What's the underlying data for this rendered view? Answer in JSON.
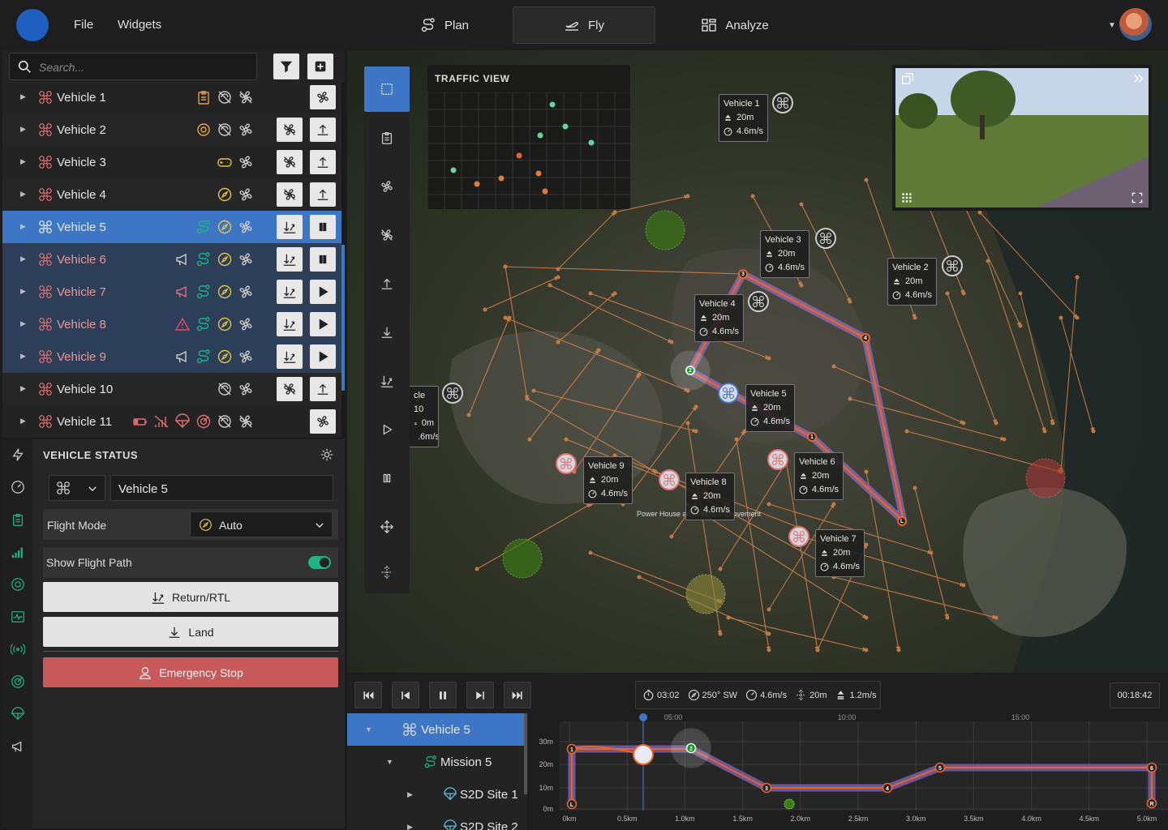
{
  "header": {
    "menu": [
      "File",
      "Widgets"
    ],
    "tabs": [
      {
        "label": "Plan",
        "icon": "route-icon",
        "active": false
      },
      {
        "label": "Fly",
        "icon": "plane-icon",
        "active": true
      },
      {
        "label": "Analyze",
        "icon": "dashboard-icon",
        "active": false
      }
    ]
  },
  "vehicles": {
    "search_placeholder": "Search...",
    "items": [
      {
        "name": "Vehicle 1",
        "state": "normal"
      },
      {
        "name": "Vehicle 2",
        "state": "normal"
      },
      {
        "name": "Vehicle 3",
        "state": "normal"
      },
      {
        "name": "Vehicle 4",
        "state": "normal"
      },
      {
        "name": "Vehicle 5",
        "state": "selected"
      },
      {
        "name": "Vehicle 6",
        "state": "group"
      },
      {
        "name": "Vehicle 7",
        "state": "group"
      },
      {
        "name": "Vehicle 8",
        "state": "group"
      },
      {
        "name": "Vehicle 9",
        "state": "group"
      },
      {
        "name": "Vehicle 10",
        "state": "normal"
      },
      {
        "name": "Vehicle 11",
        "state": "normal"
      }
    ]
  },
  "status": {
    "title": "VEHICLE STATUS",
    "vehicle_value": "Vehicle 5",
    "flight_mode_label": "Flight Mode",
    "flight_mode_value": "Auto",
    "show_path_label": "Show Flight Path",
    "show_path_on": true,
    "rtl_label": "Return/RTL",
    "land_label": "Land",
    "estop_label": "Emergency Stop"
  },
  "traffic": {
    "title": "TRAFFIC VIEW"
  },
  "map_labels": [
    {
      "name": "Vehicle 1",
      "alt": "20m",
      "speed": "4.6m/s"
    },
    {
      "name": "Vehicle 3",
      "alt": "20m",
      "speed": "4.6m/s"
    },
    {
      "name": "Vehicle 2",
      "alt": "20m",
      "speed": "4.6m/s"
    },
    {
      "name": "Vehicle 4",
      "alt": "20m",
      "speed": "4.6m/s"
    },
    {
      "name": "Vehicle 5",
      "alt": "20m",
      "speed": "4.6m/s"
    },
    {
      "name": "cle 10",
      "alt": "0m",
      "speed": ".6m/s"
    },
    {
      "name": "Vehicle 9",
      "alt": "20m",
      "speed": "4.6m/s"
    },
    {
      "name": "Vehicle 8",
      "alt": "20m",
      "speed": "4.6m/s"
    },
    {
      "name": "Vehicle 6",
      "alt": "20m",
      "speed": "4.6m/s"
    },
    {
      "name": "Vehicle 7",
      "alt": "20m",
      "speed": "4.6m/s"
    }
  ],
  "map_place": "Power House and Home Improvement",
  "waypoints": [
    "1",
    "2",
    "3",
    "4",
    "L"
  ],
  "telemetry": {
    "time": "03:02",
    "heading": "250° SW",
    "speed": "4.6m/s",
    "altitude": "20m",
    "climb": "1.2m/s",
    "clock": "00:18:42"
  },
  "tree": [
    {
      "label": "Vehicle 5",
      "level": 0,
      "icon": "drone-icon"
    },
    {
      "label": "Mission 5",
      "level": 1,
      "icon": "route-icon"
    },
    {
      "label": "S2D Site 1",
      "level": 2,
      "icon": "parachute-icon"
    },
    {
      "label": "S2D Site 2",
      "level": 2,
      "icon": "parachute-icon"
    }
  ],
  "profile": {
    "time_ticks": [
      "05:00",
      "10:00",
      "15:00"
    ],
    "y_ticks": [
      "30m",
      "20m",
      "10m",
      "0m"
    ],
    "x_ticks": [
      "0km",
      "0.5km",
      "1.0km",
      "1.5km",
      "2.0km",
      "2.5km",
      "3.0km",
      "3.5km",
      "4.0km",
      "4.5km",
      "5.0km"
    ],
    "points": [
      "1",
      "2",
      "3",
      "4",
      "5",
      "6",
      "L",
      "R"
    ]
  },
  "colors": {
    "accent": "#3d76c4",
    "path": "#e8642a",
    "path_halo": "#8c6cc0",
    "danger": "#c8595a",
    "ok": "#1db386"
  }
}
